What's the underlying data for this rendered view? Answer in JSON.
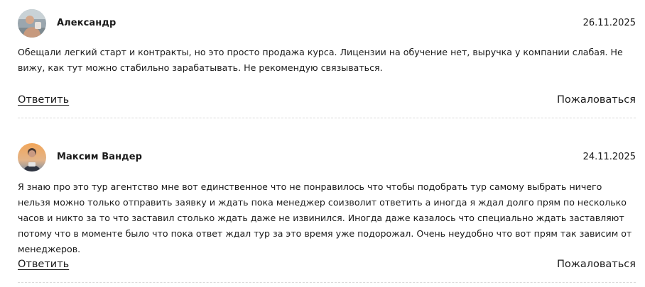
{
  "reviews": [
    {
      "author": "Александр",
      "date": "26.11.2025",
      "text": "Обещали легкий старт и контракты, но это просто продажа курса. Лицензии на обучение нет, выручка у компании слабая. Не вижу, как тут можно стабильно зарабатывать. Не рекомендую связываться.",
      "reply_label": "Ответить",
      "report_label": "Пожаловаться"
    },
    {
      "author": "Максим Вандер",
      "date": "24.11.2025",
      "text": "Я знаю про это тур агентство мне вот единственное что не понравилось что чтобы подобрать тур самому выбрать ничего нельзя можно только отправить заявку и ждать пока менеджер соизволит ответить а иногда я ждал долго прям по несколько часов и никто за то что заставил столько ждать даже не извинился. Иногда даже казалось что специально ждать заставляют потому что в моменте было что пока ответ ждал тур за это время уже подорожал. Очень неудобно что вот прям так зависим от менеджеров.",
      "reply_label": "Ответить",
      "report_label": "Пожаловаться"
    }
  ],
  "colors": {
    "text": "#1a1a1a",
    "divider": "#d8d8d8"
  }
}
